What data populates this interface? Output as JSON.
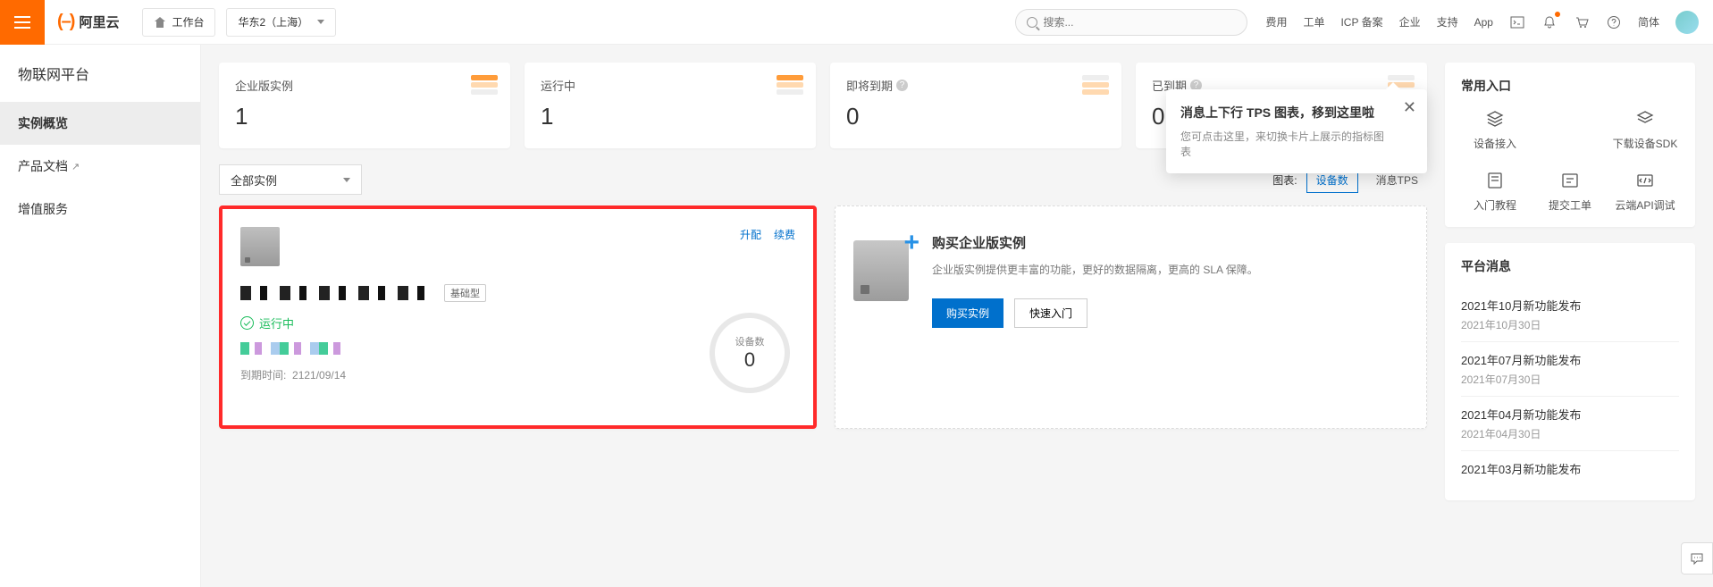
{
  "topbar": {
    "brand": "阿里云",
    "workspace": "工作台",
    "region": "华东2（上海）",
    "search_placeholder": "搜索...",
    "links": [
      "费用",
      "工单",
      "ICP 备案",
      "企业",
      "支持",
      "App"
    ],
    "lang": "简体"
  },
  "sidebar": {
    "title": "物联网平台",
    "items": [
      {
        "label": "实例概览",
        "active": true,
        "external": false
      },
      {
        "label": "产品文档",
        "active": false,
        "external": true
      },
      {
        "label": "增值服务",
        "active": false,
        "external": false
      }
    ]
  },
  "stats": [
    {
      "label": "企业版实例",
      "value": "1",
      "help": false
    },
    {
      "label": "运行中",
      "value": "1",
      "help": false
    },
    {
      "label": "即将到期",
      "value": "0",
      "help": true
    },
    {
      "label": "已到期",
      "value": "0",
      "help": true
    }
  ],
  "filter": {
    "dropdown": "全部实例"
  },
  "chart_toggle": {
    "label": "图表:",
    "tab_active": "设备数",
    "tab_other": "消息TPS"
  },
  "popover": {
    "title": "消息上下行 TPS 图表，移到这里啦",
    "body": "您可点击这里，来切换卡片上展示的指标图表"
  },
  "instance": {
    "actions": {
      "upgrade": "升配",
      "renew": "续费"
    },
    "tag": "基础型",
    "status": "运行中",
    "expire_label": "到期时间:",
    "expire_value": "2121/09/14",
    "ring_label": "设备数",
    "ring_value": "0"
  },
  "purchase": {
    "title": "购买企业版实例",
    "desc": "企业版实例提供更丰富的功能，更好的数据隔离，更高的 SLA 保障。",
    "buy_btn": "购买实例",
    "guide_btn": "快速入门"
  },
  "quick": {
    "title": "常用入口",
    "items": [
      "设备接入",
      "下载设备SDK",
      "入门教程",
      "提交工单",
      "云端API调试"
    ]
  },
  "news": {
    "title": "平台消息",
    "items": [
      {
        "t": "2021年10月新功能发布",
        "d": "2021年10月30日"
      },
      {
        "t": "2021年07月新功能发布",
        "d": "2021年07月30日"
      },
      {
        "t": "2021年04月新功能发布",
        "d": "2021年04月30日"
      },
      {
        "t": "2021年03月新功能发布",
        "d": ""
      }
    ]
  }
}
